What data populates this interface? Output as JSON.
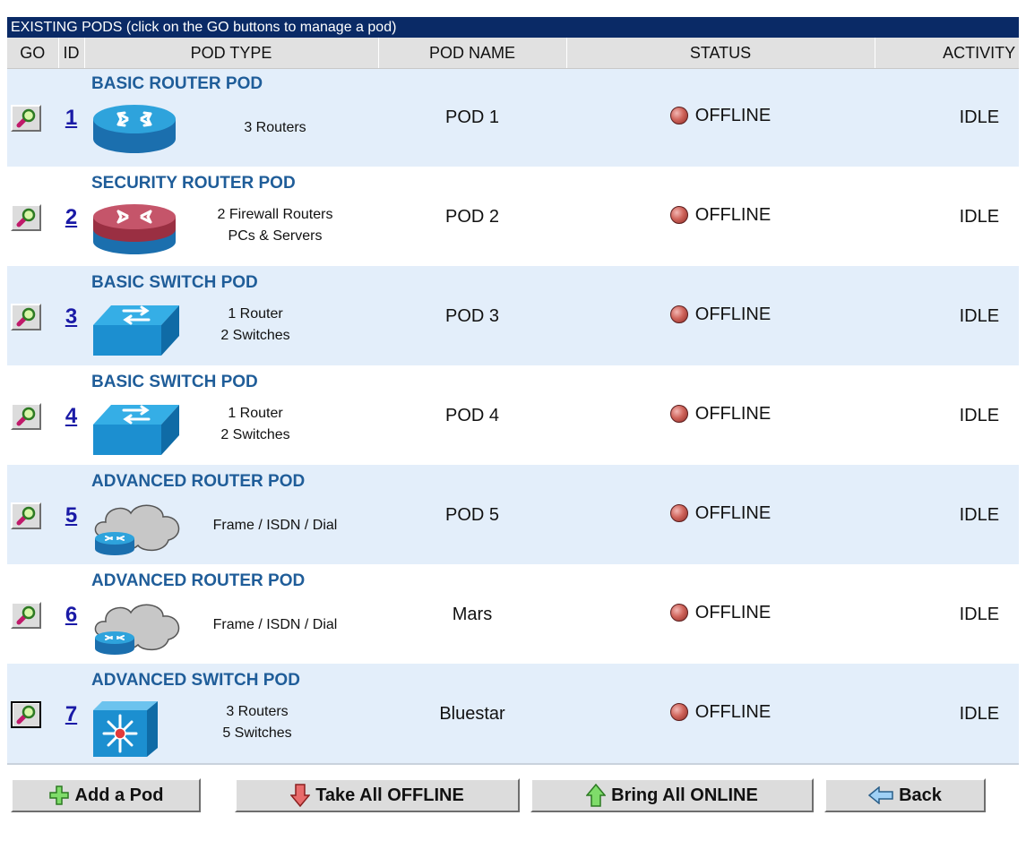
{
  "table": {
    "banner": "EXISTING PODS   (click on the GO buttons to manage a pod)",
    "headers": {
      "go": "GO",
      "id": "ID",
      "pod_type": "POD TYPE",
      "pod_name": "POD NAME",
      "status": "STATUS",
      "activity": "ACTIVITY"
    }
  },
  "pods": [
    {
      "id": "1",
      "type": "BASIC ROUTER POD",
      "icon": "router-icon",
      "desc": [
        "3 Routers"
      ],
      "name": "POD 1",
      "status": "OFFLINE",
      "activity": "IDLE"
    },
    {
      "id": "2",
      "type": "SECURITY ROUTER POD",
      "icon": "firewall-router-icon",
      "desc": [
        "2 Firewall Routers",
        "PCs & Servers"
      ],
      "name": "POD 2",
      "status": "OFFLINE",
      "activity": "IDLE"
    },
    {
      "id": "3",
      "type": "BASIC SWITCH POD",
      "icon": "switch-icon",
      "desc": [
        "1 Router",
        "2 Switches"
      ],
      "name": "POD 3",
      "status": "OFFLINE",
      "activity": "IDLE"
    },
    {
      "id": "4",
      "type": "BASIC SWITCH POD",
      "icon": "switch-icon",
      "desc": [
        "1 Router",
        "2 Switches"
      ],
      "name": "POD 4",
      "status": "OFFLINE",
      "activity": "IDLE"
    },
    {
      "id": "5",
      "type": "ADVANCED ROUTER POD",
      "icon": "cloud-router-icon",
      "desc": [
        "Frame / ISDN / Dial"
      ],
      "name": "POD 5",
      "status": "OFFLINE",
      "activity": "IDLE"
    },
    {
      "id": "6",
      "type": "ADVANCED ROUTER POD",
      "icon": "cloud-router-icon",
      "desc": [
        "Frame / ISDN / Dial"
      ],
      "name": "Mars",
      "status": "OFFLINE",
      "activity": "IDLE"
    },
    {
      "id": "7",
      "type": "ADVANCED SWITCH POD",
      "icon": "multilayer-switch-icon",
      "desc": [
        "3 Routers",
        "5 Switches"
      ],
      "name": "Bluestar",
      "status": "OFFLINE",
      "activity": "IDLE"
    }
  ],
  "actions": {
    "add": "Add a Pod",
    "offline": "Take All OFFLINE",
    "online": "Bring All ONLINE",
    "back": "Back"
  },
  "colors": {
    "banner_bg": "#0a2a66",
    "row_alt_bg": "#e3eefa",
    "pod_type_title": "#1f5d99",
    "id_link": "#1a1aa6",
    "status_led": "#c8584f"
  }
}
